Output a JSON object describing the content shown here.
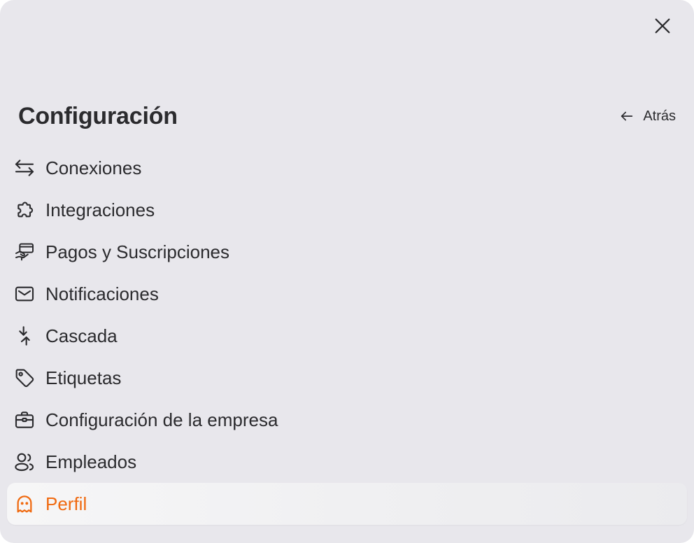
{
  "panel": {
    "title": "Configuración",
    "back_label": "Atrás"
  },
  "menu": {
    "items": [
      {
        "label": "Conexiones",
        "icon": "arrows-exchange-icon"
      },
      {
        "label": "Integraciones",
        "icon": "puzzle-icon"
      },
      {
        "label": "Pagos y Suscripciones",
        "icon": "hand-card-icon"
      },
      {
        "label": "Notificaciones",
        "icon": "mail-icon"
      },
      {
        "label": "Cascada",
        "icon": "arrows-merge-icon"
      },
      {
        "label": "Etiquetas",
        "icon": "tag-icon"
      },
      {
        "label": "Configuración de la empresa",
        "icon": "briefcase-icon"
      },
      {
        "label": "Empleados",
        "icon": "users-icon"
      },
      {
        "label": "Perfil",
        "icon": "ghost-icon",
        "active": true
      }
    ]
  },
  "colors": {
    "background": "#e8e7ec",
    "text": "#2b2b2e",
    "accent": "#f06a10"
  }
}
